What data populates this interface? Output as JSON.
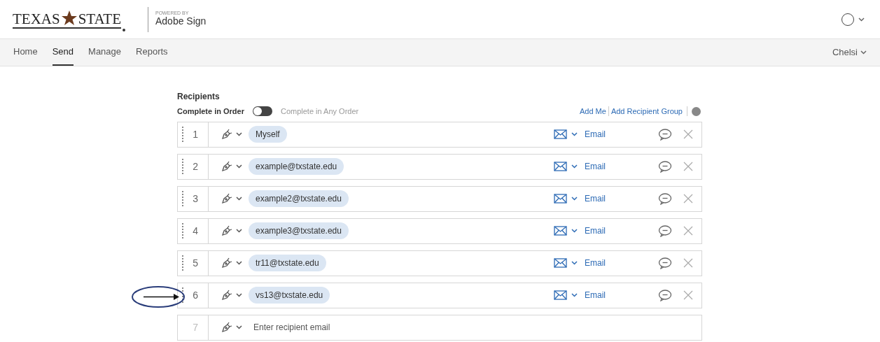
{
  "header": {
    "logo": {
      "left": "TEXAS",
      "right": "STATE"
    },
    "powered_by": "POWERED BY",
    "product": "Adobe Sign"
  },
  "nav": {
    "tabs": [
      {
        "label": "Home",
        "selected": false
      },
      {
        "label": "Send",
        "selected": true
      },
      {
        "label": "Manage",
        "selected": false
      },
      {
        "label": "Reports",
        "selected": false
      }
    ],
    "user": "Chelsi"
  },
  "recipients": {
    "title": "Recipients",
    "order_toggle": {
      "left_label": "Complete in Order",
      "right_label": "Complete in Any Order",
      "on": false
    },
    "links": [
      "Add Me",
      "Add Recipient Group"
    ],
    "rows": [
      {
        "kind": "recipient",
        "number": "1",
        "name": "Myself",
        "delivery": "Email"
      },
      {
        "kind": "recipient",
        "number": "2",
        "name": "example@txstate.edu",
        "delivery": "Email"
      },
      {
        "kind": "recipient",
        "number": "3",
        "name": "example2@txstate.edu",
        "delivery": "Email"
      },
      {
        "kind": "recipient",
        "number": "4",
        "name": "example3@txstate.edu",
        "delivery": "Email"
      },
      {
        "kind": "recipient",
        "number": "5",
        "name": "tr11@txstate.edu",
        "delivery": "Email"
      },
      {
        "kind": "recipient",
        "number": "6",
        "name": "vs13@txstate.edu",
        "delivery": "Email",
        "annotated": true
      },
      {
        "kind": "empty",
        "number": "7",
        "placeholder": "Enter recipient email"
      }
    ]
  }
}
